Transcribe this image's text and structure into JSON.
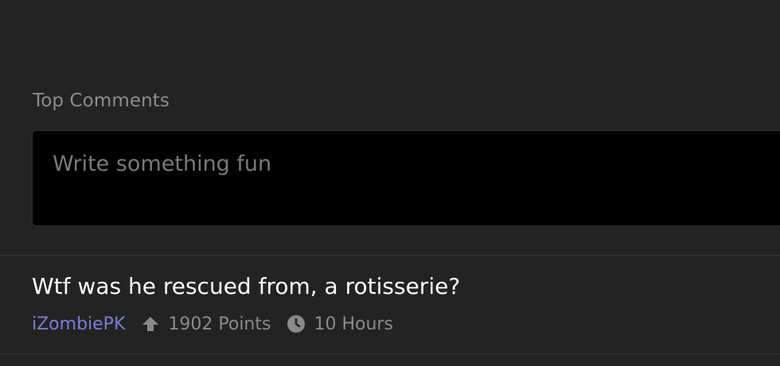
{
  "section": {
    "title": "Top Comments"
  },
  "composer": {
    "placeholder": "Write something fun",
    "value": ""
  },
  "comments": [
    {
      "text": "Wtf was he rescued from, a rotisserie?",
      "author": "iZombiePK",
      "points": "1902 Points",
      "age": "10 Hours",
      "icons": [
        "upvote-arrow-icon",
        "clock-icon"
      ]
    }
  ],
  "colors": {
    "background": "#232323",
    "input_background": "#000000",
    "author_link": "#7b7bd9",
    "muted_text": "#8a8a8a",
    "comment_text": "#ffffff"
  }
}
